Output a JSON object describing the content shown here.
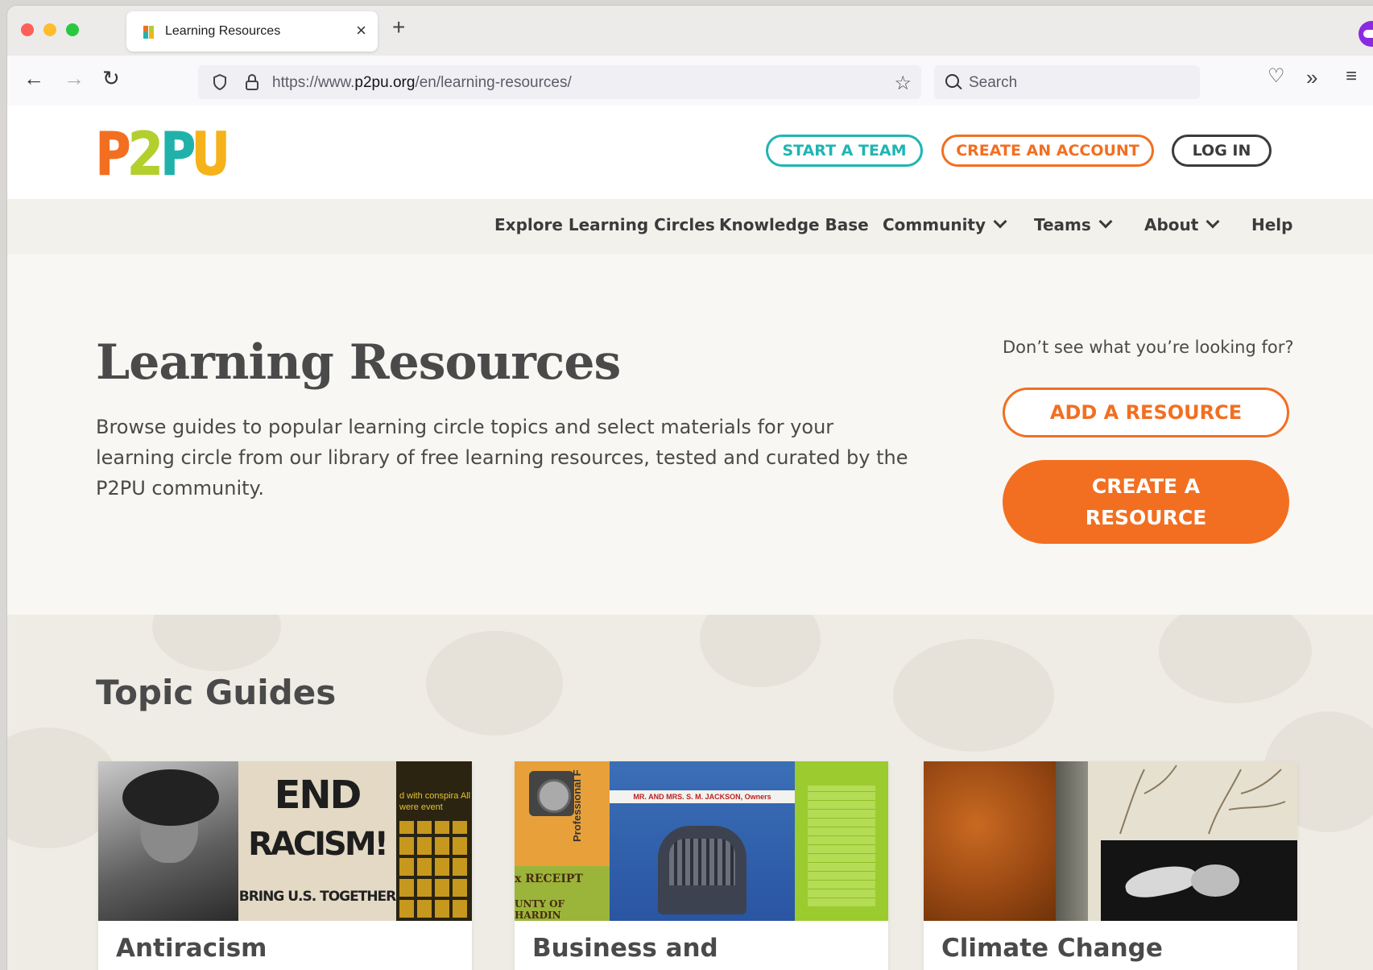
{
  "browser": {
    "tab_title": "Learning Resources",
    "tab_close": "×",
    "new_tab": "+",
    "url_prefix": "https://www.",
    "url_domain": "p2pu.org",
    "url_path": "/en/learning-resources/",
    "search_placeholder": "Search",
    "icons": [
      "back-arrow-icon",
      "forward-arrow-icon",
      "reload-icon",
      "shield-icon",
      "lock-icon",
      "bookmark-star-icon",
      "search-icon",
      "pocket-icon",
      "overflow-chevrons-icon",
      "hamburger-menu-icon",
      "extension-mask-icon"
    ]
  },
  "header": {
    "logo": [
      "P",
      "2",
      "P",
      "U"
    ],
    "start_team": "START A TEAM",
    "create_account": "CREATE AN ACCOUNT",
    "log_in": "LOG IN",
    "colors": {
      "orange": "#f26f21",
      "teal": "#1fb5b4",
      "lime": "#b3cf2e",
      "gold": "#f6b21b",
      "dark": "#3b3b3b"
    }
  },
  "nav": {
    "items": [
      {
        "label": "Explore Learning Circles",
        "dropdown": false
      },
      {
        "label": "Knowledge Base",
        "dropdown": false
      },
      {
        "label": "Community",
        "dropdown": true
      },
      {
        "label": "Teams",
        "dropdown": true
      },
      {
        "label": "About",
        "dropdown": true
      },
      {
        "label": "Help",
        "dropdown": false
      }
    ]
  },
  "hero": {
    "title": "Learning Resources",
    "intro": "Browse guides to popular learning circle topics and select materials for your learning circle from our library of free learning resources, tested and curated by the P2PU community.",
    "cta_question": "Don’t see what you’re looking for?",
    "add_resource": "ADD A RESOURCE",
    "create_resource": "CREATE A RESOURCE"
  },
  "topics": {
    "title": "Topic Guides",
    "cards": [
      {
        "title": "Antiracism",
        "collage": {
          "poster_line1": "END",
          "poster_line2": "RACISM!",
          "poster_line3": "BRING U.S. TOGETHER",
          "snippet": "d with conspira All were event"
        }
      },
      {
        "title": "Business and",
        "collage": {
          "side_label": "Professional F",
          "banner": "MR. AND MRS. S. M. JACKSON, Owners",
          "receipt": "x RECEIPT",
          "county": "UNTY OF HARDIN"
        }
      },
      {
        "title": "Climate Change",
        "collage": {}
      }
    ]
  }
}
